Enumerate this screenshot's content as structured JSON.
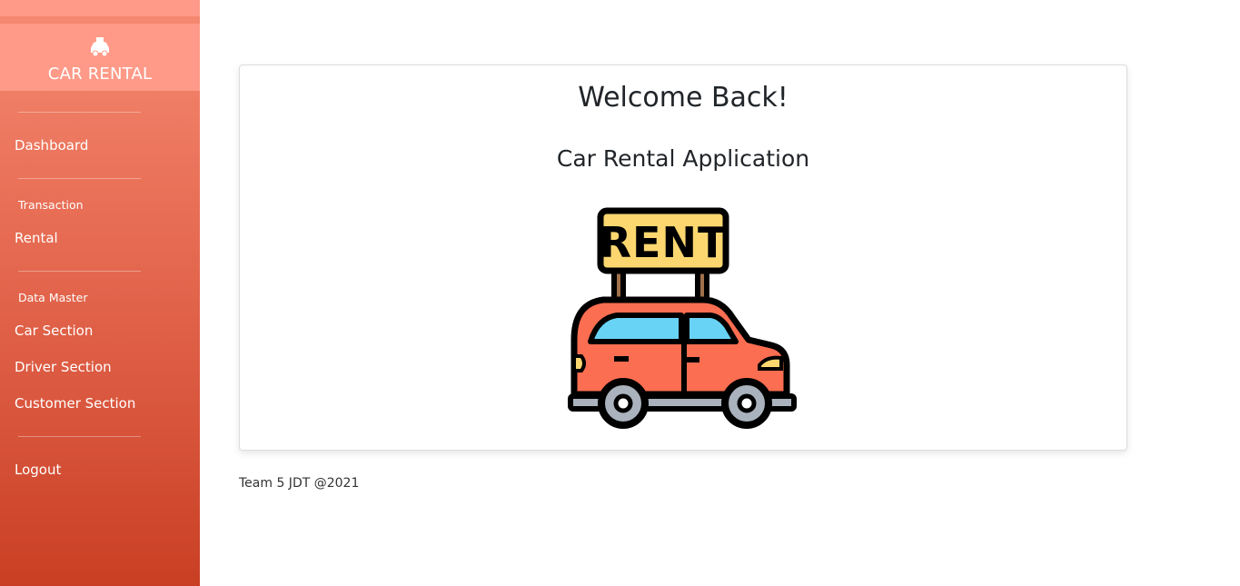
{
  "sidebar": {
    "brand": {
      "icon": "car-icon",
      "title": "CAR RENTAL"
    },
    "dashboard_label": "Dashboard",
    "transaction_heading": "Transaction",
    "rental_label": "Rental",
    "data_master_heading": "Data Master",
    "car_section_label": "Car Section",
    "driver_section_label": "Driver Section",
    "customer_section_label": "Customer Section",
    "logout_label": "Logout"
  },
  "main": {
    "welcome_title": "Welcome Back!",
    "subtitle": "Car Rental Application",
    "illustration": {
      "icon": "rent-car-icon",
      "sign_text": "RENT"
    }
  },
  "footer": {
    "text": "Team 5 JDT @2021"
  },
  "colors": {
    "sidebar_top": "#f58a72",
    "sidebar_bottom": "#c93f24",
    "brand_bg": "#ff9a88",
    "sign_yellow": "#fcd770",
    "car_body": "#fc6e51",
    "car_window": "#69d3f5",
    "tire_gray": "#aab2bd"
  }
}
